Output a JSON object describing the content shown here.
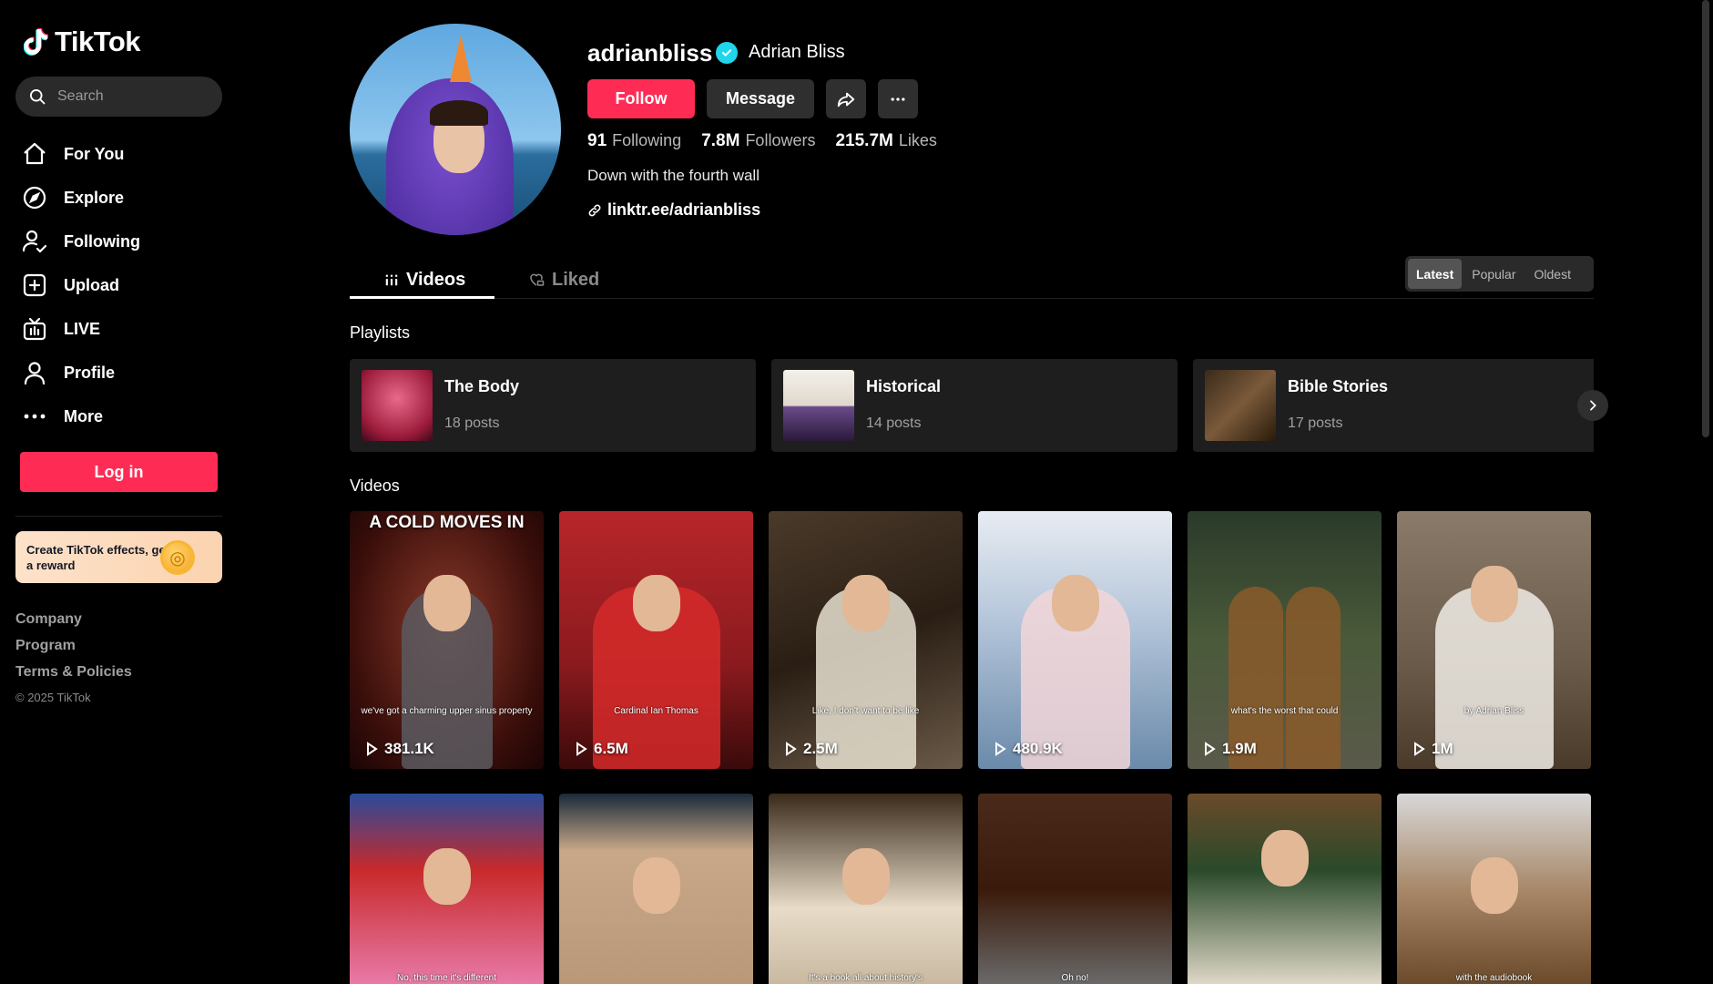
{
  "brand": {
    "name": "TikTok"
  },
  "search": {
    "placeholder": "Search"
  },
  "nav": {
    "items": [
      {
        "label": "For You",
        "icon": "home-icon"
      },
      {
        "label": "Explore",
        "icon": "compass-icon"
      },
      {
        "label": "Following",
        "icon": "following-icon"
      },
      {
        "label": "Upload",
        "icon": "upload-icon"
      },
      {
        "label": "LIVE",
        "icon": "live-icon"
      },
      {
        "label": "Profile",
        "icon": "profile-icon"
      },
      {
        "label": "More",
        "icon": "more-icon"
      }
    ]
  },
  "login": {
    "label": "Log in"
  },
  "promo": {
    "text": "Create TikTok effects, get a reward"
  },
  "footer": {
    "links": [
      "Company",
      "Program",
      "Terms & Policies"
    ],
    "copyright": "© 2025 TikTok"
  },
  "profile": {
    "username": "adrianbliss",
    "display_name": "Adrian Bliss",
    "follow_label": "Follow",
    "message_label": "Message",
    "stats": [
      {
        "value": "91",
        "label": "Following"
      },
      {
        "value": "7.8M",
        "label": "Followers"
      },
      {
        "value": "215.7M",
        "label": "Likes"
      }
    ],
    "bio": "Down with the fourth wall",
    "link": "linktr.ee/adrianbliss"
  },
  "tabs": {
    "videos": "Videos",
    "liked": "Liked"
  },
  "sort": {
    "options": [
      "Latest",
      "Popular",
      "Oldest"
    ],
    "active": "Latest"
  },
  "sections": {
    "playlists": "Playlists",
    "videos": "Videos"
  },
  "playlists": [
    {
      "title": "The Body",
      "count": "18 posts"
    },
    {
      "title": "Historical",
      "count": "14 posts"
    },
    {
      "title": "Bible Stories",
      "count": "17 posts"
    }
  ],
  "videos_row1": [
    {
      "views": "381.1K",
      "overlay": "A COLD MOVES IN",
      "caption": "we've got a charming upper sinus property"
    },
    {
      "views": "6.5M",
      "overlay": "",
      "caption": "Cardinal Ian Thomas"
    },
    {
      "views": "2.5M",
      "overlay": "",
      "caption": "Like, I don't want to be like"
    },
    {
      "views": "480.9K",
      "overlay": "",
      "caption": ""
    },
    {
      "views": "1.9M",
      "overlay": "",
      "caption": "what's the worst that could"
    },
    {
      "views": "1M",
      "overlay": "",
      "caption": "by Adrian Bliss"
    }
  ],
  "videos_row2": [
    {
      "caption": "No, this time it's different"
    },
    {
      "caption": ""
    },
    {
      "caption": "It's a book all about history's"
    },
    {
      "caption": "Oh no!"
    },
    {
      "caption": ""
    },
    {
      "caption": "with the audiobook"
    }
  ],
  "colors": {
    "accent": "#fe2c55",
    "verified": "#20d5ec",
    "background": "#000000"
  }
}
